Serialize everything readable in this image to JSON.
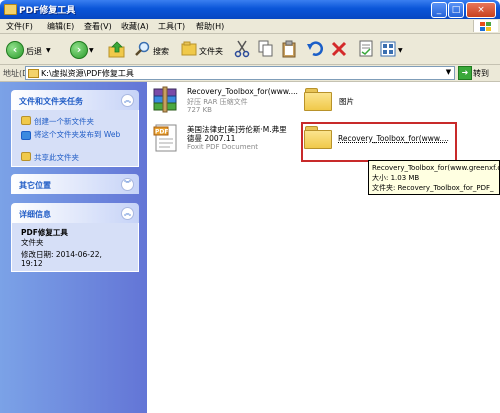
{
  "window": {
    "title": "PDF修复工具",
    "min_label": "_",
    "max_label": "□",
    "close_label": "×"
  },
  "menu": [
    "文件(F)",
    "编辑(E)",
    "查看(V)",
    "收藏(A)",
    "工具(T)",
    "帮助(H)"
  ],
  "toolbar": {
    "back_label": "后退",
    "search_label": "搜索",
    "folders_label": "文件夹"
  },
  "address": {
    "label": "地址(D)",
    "path": "K:\\虚拟资源\\PDF修复工具",
    "go_label": "转到"
  },
  "tasks": {
    "file_tasks": {
      "title": "文件和文件夹任务",
      "links": [
        "创建一个新文件夹",
        "将这个文件夹发布到 Web",
        "共享此文件夹"
      ]
    },
    "other_places": {
      "title": "其它位置"
    },
    "details": {
      "title": "详细信息",
      "name": "PDF修复工具",
      "type": "文件夹",
      "modified_label": "修改日期: 2014-06-22,",
      "modified_time": "19:12"
    }
  },
  "files": [
    {
      "name": "Recovery_Toolbox_for(www....",
      "type": "好压 RAR 压缩文件",
      "size": "727 KB",
      "icon": "rar-archive-icon"
    },
    {
      "name": "图片",
      "icon": "folder-icon"
    },
    {
      "name": "美国法律史[美]劳伦斯·M.弗里德曼 2007.11",
      "name_line1": "美国法律史[美]劳伦斯·M.弗里",
      "name_line2": "德曼 2007.11",
      "type": "Foxit PDF Document",
      "icon": "pdf-icon"
    },
    {
      "name": "Recovery_Toolbox_for(www....",
      "icon": "folder-icon"
    }
  ],
  "tooltip": {
    "line1": "Recovery_Toolbox_for(www.greenxf.c",
    "line2": "大小: 1.03 MB",
    "line3": "文件夹: Recovery_Toolbox_for_PDF_"
  },
  "colors": {
    "titlebar": "#0a55d8",
    "taskpane": "#6375d6",
    "highlight": "#c82a2a",
    "tooltip_bg": "#ffffe1"
  }
}
